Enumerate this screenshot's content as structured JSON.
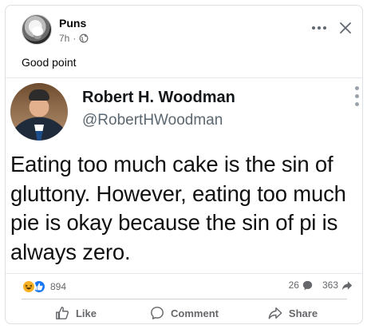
{
  "post": {
    "page_name": "Puns",
    "time": "7h",
    "caption": "Good point",
    "icons": {
      "more": "more-horizontal-icon",
      "close": "close-icon",
      "audience": "globe-icon"
    }
  },
  "tweet": {
    "name": "Robert H. Woodman",
    "handle": "@RobertHWoodman",
    "text": "Eating too much cake is the sin of gluttony. However, eating too much pie is okay because the sin of pi is always zero."
  },
  "reactions": {
    "types": [
      "haha",
      "like"
    ],
    "count": "894"
  },
  "engagement": {
    "comments": "26",
    "shares": "363"
  },
  "actions": {
    "like": "Like",
    "comment": "Comment",
    "share": "Share"
  },
  "colors": {
    "accent": "#1877f2",
    "haha": "#f7b125",
    "secondary_text": "#65676b"
  }
}
